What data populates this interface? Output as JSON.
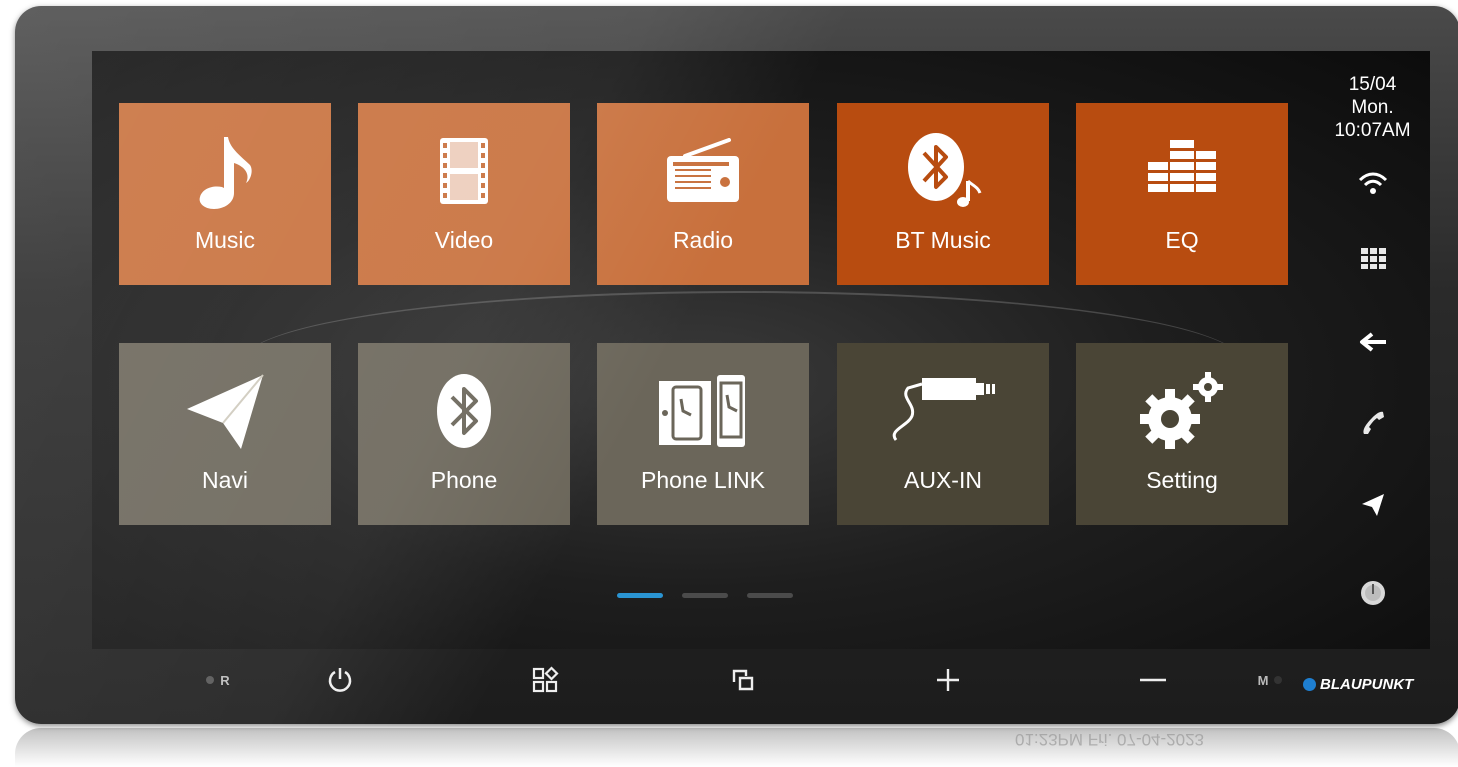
{
  "status": {
    "date": "15/04",
    "day": "Mon.",
    "time": "10:07AM"
  },
  "apps": [
    {
      "label": "Music",
      "icon": "music-note-icon",
      "color": "#c8703c"
    },
    {
      "label": "Video",
      "icon": "film-strip-icon",
      "color": "#c8703c"
    },
    {
      "label": "Radio",
      "icon": "radio-icon",
      "color": "#c8703c"
    },
    {
      "label": "BT Music",
      "icon": "bluetooth-music-icon",
      "color": "#b84c10"
    },
    {
      "label": "EQ",
      "icon": "equalizer-icon",
      "color": "#b84c10"
    },
    {
      "label": "Navi",
      "icon": "navigation-arrow-icon",
      "color": "#6b665a"
    },
    {
      "label": "Phone",
      "icon": "bluetooth-icon",
      "color": "#6b665a"
    },
    {
      "label": "Phone LINK",
      "icon": "phone-link-icon",
      "color": "#6b665a"
    },
    {
      "label": "AUX-IN",
      "icon": "aux-cable-icon",
      "color": "#4a4536"
    },
    {
      "label": "Setting",
      "icon": "gears-icon",
      "color": "#4a4536"
    }
  ],
  "sidebar_icons": [
    "wifi-icon",
    "apps-grid-icon",
    "back-arrow-icon",
    "phone-handset-icon",
    "navigation-arrow-icon",
    "volume-knob-icon"
  ],
  "pager": {
    "pages": 3,
    "active": 1,
    "active_color": "#2a94d2"
  },
  "hardware": {
    "reset_label": "R",
    "mute_label": "M",
    "brand": "BLAUPUNKT",
    "buttons": [
      "power-icon",
      "home-apps-icon",
      "screen-switch-icon",
      "volume-up-icon",
      "volume-down-icon"
    ]
  },
  "reflection_text": "01:23PM Fri. 07-04-2023"
}
